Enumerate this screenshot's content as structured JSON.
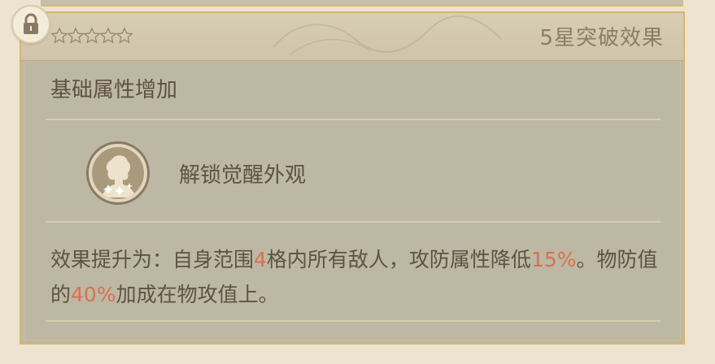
{
  "header": {
    "title": "5星突破效果",
    "stars": 5,
    "lock_icon": "lock-icon"
  },
  "section": {
    "title": "基础属性增加"
  },
  "unlock": {
    "label": "解锁觉醒外观",
    "icon": "character-portrait-icon"
  },
  "effect": {
    "prefix": "效果提升为：自身范围",
    "range": "4",
    "mid1": "格内所有敌人，攻防属性降低",
    "reduce": "15%",
    "mid2": "。物防值的",
    "ratio": "40%",
    "suffix": "加成在物攻值上。"
  },
  "colors": {
    "highlight": "#d9704f",
    "text": "#5e5242",
    "border": "#d8b56e"
  }
}
